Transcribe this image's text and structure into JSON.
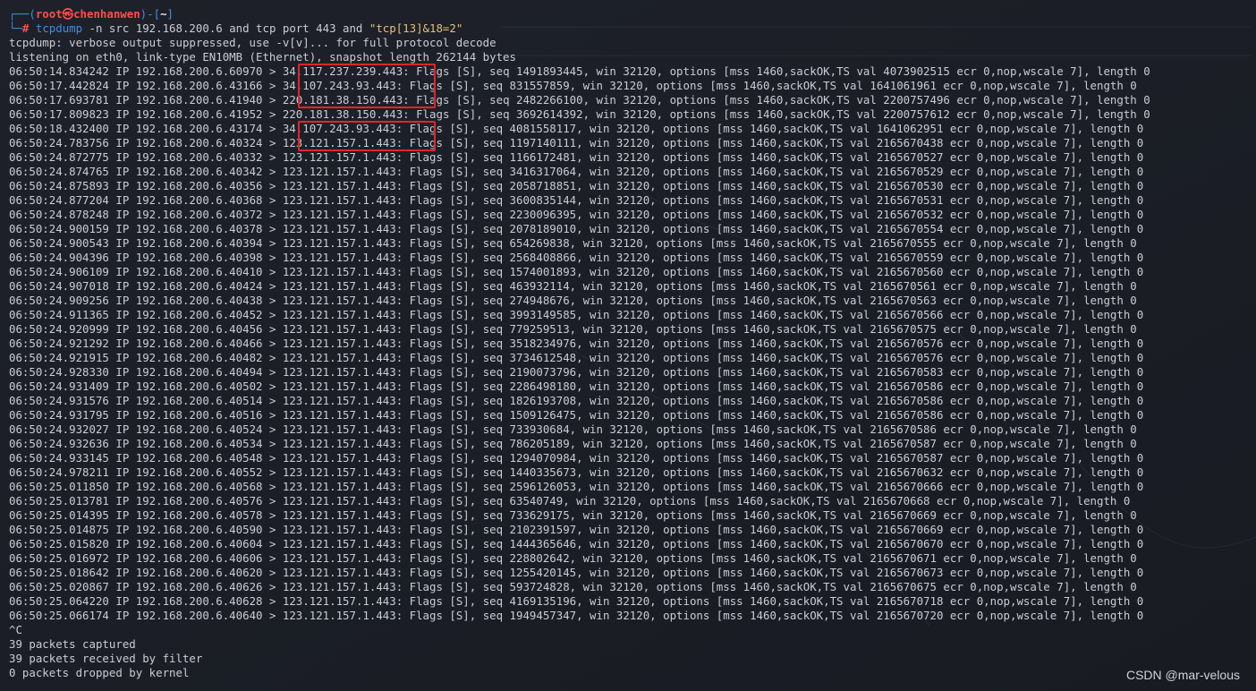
{
  "prompt": {
    "corner_top": "┌──(",
    "user_host": "root㉿chenhanwen",
    "mid": ")-[",
    "dir": "~",
    "close": "]",
    "corner_bottom": "└─",
    "hash": "#"
  },
  "command": {
    "program": "tcpdump",
    "args": " -n src 192.168.200.6 and tcp port 443 and ",
    "filter": "\"tcp[13]&18=2\""
  },
  "header_lines": [
    "tcpdump: verbose output suppressed, use -v[v]... for full protocol decode",
    "listening on eth0, link-type EN10MB (Ethernet), snapshot length 262144 bytes"
  ],
  "packets": [
    {
      "time": "06:50:14.834242",
      "src": "192.168.200.6.60970",
      "dst": "34.117.237.239.443:",
      "rest": " Flags [S], seq 1491893445, win 32120, options [mss 1460,sackOK,TS val 4073902515 ecr 0,nop,wscale 7], length 0"
    },
    {
      "time": "06:50:17.442824",
      "src": "192.168.200.6.43166",
      "dst": "34.107.243.93.443:",
      "rest": " Flags [S], seq 831557859, win 32120, options [mss 1460,sackOK,TS val 1641061961 ecr 0,nop,wscale 7], length 0"
    },
    {
      "time": "06:50:17.693781",
      "src": "192.168.200.6.41940",
      "dst": "220.181.38.150.443:",
      "rest": " Flags [S], seq 2482266100, win 32120, options [mss 1460,sackOK,TS val 2200757496 ecr 0,nop,wscale 7], length 0"
    },
    {
      "time": "06:50:17.809823",
      "src": "192.168.200.6.41952",
      "dst": "220.181.38.150.443:",
      "rest": " Flags [S], seq 3692614392, win 32120, options [mss 1460,sackOK,TS val 2200757612 ecr 0,nop,wscale 7], length 0"
    },
    {
      "time": "06:50:18.432400",
      "src": "192.168.200.6.43174",
      "dst": "34.107.243.93.443:",
      "rest": " Flags [S], seq 4081558117, win 32120, options [mss 1460,sackOK,TS val 1641062951 ecr 0,nop,wscale 7], length 0"
    },
    {
      "time": "06:50:24.783756",
      "src": "192.168.200.6.40324",
      "dst": "123.121.157.1.443:",
      "rest": " Flags [S], seq 1197140111, win 32120, options [mss 1460,sackOK,TS val 2165670438 ecr 0,nop,wscale 7], length 0"
    },
    {
      "time": "06:50:24.872775",
      "src": "192.168.200.6.40332",
      "dst": "123.121.157.1.443:",
      "rest": " Flags [S], seq 1166172481, win 32120, options [mss 1460,sackOK,TS val 2165670527 ecr 0,nop,wscale 7], length 0"
    },
    {
      "time": "06:50:24.874765",
      "src": "192.168.200.6.40342",
      "dst": "123.121.157.1.443:",
      "rest": " Flags [S], seq 3416317064, win 32120, options [mss 1460,sackOK,TS val 2165670529 ecr 0,nop,wscale 7], length 0"
    },
    {
      "time": "06:50:24.875893",
      "src": "192.168.200.6.40356",
      "dst": "123.121.157.1.443:",
      "rest": " Flags [S], seq 2058718851, win 32120, options [mss 1460,sackOK,TS val 2165670530 ecr 0,nop,wscale 7], length 0"
    },
    {
      "time": "06:50:24.877204",
      "src": "192.168.200.6.40368",
      "dst": "123.121.157.1.443:",
      "rest": " Flags [S], seq 3600835144, win 32120, options [mss 1460,sackOK,TS val 2165670531 ecr 0,nop,wscale 7], length 0"
    },
    {
      "time": "06:50:24.878248",
      "src": "192.168.200.6.40372",
      "dst": "123.121.157.1.443:",
      "rest": " Flags [S], seq 2230096395, win 32120, options [mss 1460,sackOK,TS val 2165670532 ecr 0,nop,wscale 7], length 0"
    },
    {
      "time": "06:50:24.900159",
      "src": "192.168.200.6.40378",
      "dst": "123.121.157.1.443:",
      "rest": " Flags [S], seq 2078189010, win 32120, options [mss 1460,sackOK,TS val 2165670554 ecr 0,nop,wscale 7], length 0"
    },
    {
      "time": "06:50:24.900543",
      "src": "192.168.200.6.40394",
      "dst": "123.121.157.1.443:",
      "rest": " Flags [S], seq 654269838, win 32120, options [mss 1460,sackOK,TS val 2165670555 ecr 0,nop,wscale 7], length 0"
    },
    {
      "time": "06:50:24.904396",
      "src": "192.168.200.6.40398",
      "dst": "123.121.157.1.443:",
      "rest": " Flags [S], seq 2568408866, win 32120, options [mss 1460,sackOK,TS val 2165670559 ecr 0,nop,wscale 7], length 0"
    },
    {
      "time": "06:50:24.906109",
      "src": "192.168.200.6.40410",
      "dst": "123.121.157.1.443:",
      "rest": " Flags [S], seq 1574001893, win 32120, options [mss 1460,sackOK,TS val 2165670560 ecr 0,nop,wscale 7], length 0"
    },
    {
      "time": "06:50:24.907018",
      "src": "192.168.200.6.40424",
      "dst": "123.121.157.1.443:",
      "rest": " Flags [S], seq 463932114, win 32120, options [mss 1460,sackOK,TS val 2165670561 ecr 0,nop,wscale 7], length 0"
    },
    {
      "time": "06:50:24.909256",
      "src": "192.168.200.6.40438",
      "dst": "123.121.157.1.443:",
      "rest": " Flags [S], seq 274948676, win 32120, options [mss 1460,sackOK,TS val 2165670563 ecr 0,nop,wscale 7], length 0"
    },
    {
      "time": "06:50:24.911365",
      "src": "192.168.200.6.40452",
      "dst": "123.121.157.1.443:",
      "rest": " Flags [S], seq 3993149585, win 32120, options [mss 1460,sackOK,TS val 2165670566 ecr 0,nop,wscale 7], length 0"
    },
    {
      "time": "06:50:24.920999",
      "src": "192.168.200.6.40456",
      "dst": "123.121.157.1.443:",
      "rest": " Flags [S], seq 779259513, win 32120, options [mss 1460,sackOK,TS val 2165670575 ecr 0,nop,wscale 7], length 0"
    },
    {
      "time": "06:50:24.921292",
      "src": "192.168.200.6.40466",
      "dst": "123.121.157.1.443:",
      "rest": " Flags [S], seq 3518234976, win 32120, options [mss 1460,sackOK,TS val 2165670576 ecr 0,nop,wscale 7], length 0"
    },
    {
      "time": "06:50:24.921915",
      "src": "192.168.200.6.40482",
      "dst": "123.121.157.1.443:",
      "rest": " Flags [S], seq 3734612548, win 32120, options [mss 1460,sackOK,TS val 2165670576 ecr 0,nop,wscale 7], length 0"
    },
    {
      "time": "06:50:24.928330",
      "src": "192.168.200.6.40494",
      "dst": "123.121.157.1.443:",
      "rest": " Flags [S], seq 2190073796, win 32120, options [mss 1460,sackOK,TS val 2165670583 ecr 0,nop,wscale 7], length 0"
    },
    {
      "time": "06:50:24.931409",
      "src": "192.168.200.6.40502",
      "dst": "123.121.157.1.443:",
      "rest": " Flags [S], seq 2286498180, win 32120, options [mss 1460,sackOK,TS val 2165670586 ecr 0,nop,wscale 7], length 0"
    },
    {
      "time": "06:50:24.931576",
      "src": "192.168.200.6.40514",
      "dst": "123.121.157.1.443:",
      "rest": " Flags [S], seq 1826193708, win 32120, options [mss 1460,sackOK,TS val 2165670586 ecr 0,nop,wscale 7], length 0"
    },
    {
      "time": "06:50:24.931795",
      "src": "192.168.200.6.40516",
      "dst": "123.121.157.1.443:",
      "rest": " Flags [S], seq 1509126475, win 32120, options [mss 1460,sackOK,TS val 2165670586 ecr 0,nop,wscale 7], length 0"
    },
    {
      "time": "06:50:24.932027",
      "src": "192.168.200.6.40524",
      "dst": "123.121.157.1.443:",
      "rest": " Flags [S], seq 733930684, win 32120, options [mss 1460,sackOK,TS val 2165670586 ecr 0,nop,wscale 7], length 0"
    },
    {
      "time": "06:50:24.932636",
      "src": "192.168.200.6.40534",
      "dst": "123.121.157.1.443:",
      "rest": " Flags [S], seq 786205189, win 32120, options [mss 1460,sackOK,TS val 2165670587 ecr 0,nop,wscale 7], length 0"
    },
    {
      "time": "06:50:24.933145",
      "src": "192.168.200.6.40548",
      "dst": "123.121.157.1.443:",
      "rest": " Flags [S], seq 1294070984, win 32120, options [mss 1460,sackOK,TS val 2165670587 ecr 0,nop,wscale 7], length 0"
    },
    {
      "time": "06:50:24.978211",
      "src": "192.168.200.6.40552",
      "dst": "123.121.157.1.443:",
      "rest": " Flags [S], seq 1440335673, win 32120, options [mss 1460,sackOK,TS val 2165670632 ecr 0,nop,wscale 7], length 0"
    },
    {
      "time": "06:50:25.011850",
      "src": "192.168.200.6.40568",
      "dst": "123.121.157.1.443:",
      "rest": " Flags [S], seq 2596126053, win 32120, options [mss 1460,sackOK,TS val 2165670666 ecr 0,nop,wscale 7], length 0"
    },
    {
      "time": "06:50:25.013781",
      "src": "192.168.200.6.40576",
      "dst": "123.121.157.1.443:",
      "rest": " Flags [S], seq 63540749, win 32120, options [mss 1460,sackOK,TS val 2165670668 ecr 0,nop,wscale 7], length 0"
    },
    {
      "time": "06:50:25.014395",
      "src": "192.168.200.6.40578",
      "dst": "123.121.157.1.443:",
      "rest": " Flags [S], seq 733629175, win 32120, options [mss 1460,sackOK,TS val 2165670669 ecr 0,nop,wscale 7], length 0"
    },
    {
      "time": "06:50:25.014875",
      "src": "192.168.200.6.40590",
      "dst": "123.121.157.1.443:",
      "rest": " Flags [S], seq 2102391597, win 32120, options [mss 1460,sackOK,TS val 2165670669 ecr 0,nop,wscale 7], length 0"
    },
    {
      "time": "06:50:25.015820",
      "src": "192.168.200.6.40604",
      "dst": "123.121.157.1.443:",
      "rest": " Flags [S], seq 1444365646, win 32120, options [mss 1460,sackOK,TS val 2165670670 ecr 0,nop,wscale 7], length 0"
    },
    {
      "time": "06:50:25.016972",
      "src": "192.168.200.6.40606",
      "dst": "123.121.157.1.443:",
      "rest": " Flags [S], seq 228802642, win 32120, options [mss 1460,sackOK,TS val 2165670671 ecr 0,nop,wscale 7], length 0"
    },
    {
      "time": "06:50:25.018642",
      "src": "192.168.200.6.40620",
      "dst": "123.121.157.1.443:",
      "rest": " Flags [S], seq 1255420145, win 32120, options [mss 1460,sackOK,TS val 2165670673 ecr 0,nop,wscale 7], length 0"
    },
    {
      "time": "06:50:25.020867",
      "src": "192.168.200.6.40626",
      "dst": "123.121.157.1.443:",
      "rest": " Flags [S], seq 593724828, win 32120, options [mss 1460,sackOK,TS val 2165670675 ecr 0,nop,wscale 7], length 0"
    },
    {
      "time": "06:50:25.064220",
      "src": "192.168.200.6.40628",
      "dst": "123.121.157.1.443:",
      "rest": " Flags [S], seq 4169135196, win 32120, options [mss 1460,sackOK,TS val 2165670718 ecr 0,nop,wscale 7], length 0"
    },
    {
      "time": "06:50:25.066174",
      "src": "192.168.200.6.40640",
      "dst": "123.121.157.1.443:",
      "rest": " Flags [S], seq 1949457347, win 32120, options [mss 1460,sackOK,TS val 2165670720 ecr 0,nop,wscale 7], length 0"
    }
  ],
  "footer_lines": [
    "^C",
    "39 packets captured",
    "39 packets received by filter",
    "0 packets dropped by kernel"
  ],
  "watermark": "CSDN @mar-velous",
  "colors": {
    "background": "#1b1e26",
    "text": "#c9cdd4",
    "prompt_blue": "#3b8eea",
    "prompt_red": "#ff4d4d",
    "string_yellow": "#e5c07b",
    "highlight_red": "#e0262b"
  }
}
